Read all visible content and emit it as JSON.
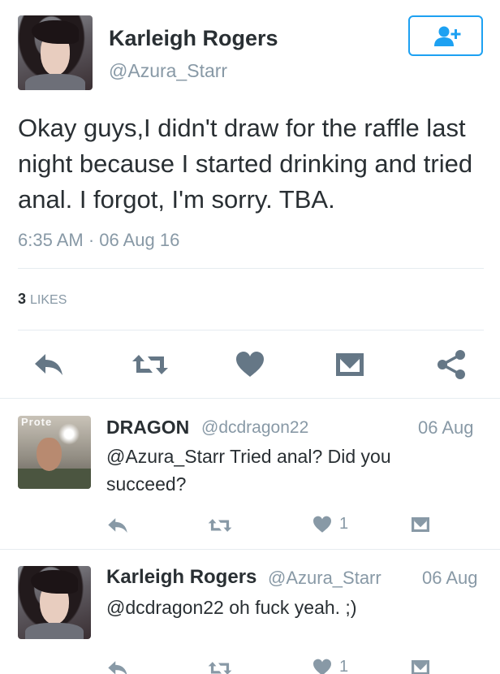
{
  "colors": {
    "text": "#292f33",
    "secondary": "#8899a6",
    "accent": "#1da1f2",
    "icon": "#657786",
    "divider": "#e6ecf0"
  },
  "tweet": {
    "author_name": "Karleigh Rogers",
    "author_handle": "@Azura_Starr",
    "follow_icon": "add-user-icon",
    "text": "Okay guys,I didn't draw for the raffle last night because I started drinking and tried anal. I forgot, I'm sorry.  TBA.",
    "timestamp": "6:35 AM · 06 Aug 16",
    "likes_count": "3",
    "likes_label": "LIKES",
    "actions": [
      "reply-icon",
      "retweet-icon",
      "heart-icon",
      "message-icon",
      "share-icon"
    ]
  },
  "replies": [
    {
      "name": "DRAGON",
      "handle": "@dcdragon22",
      "date": "06 Aug",
      "avatar_watermark": "Prote",
      "text": "@Azura_Starr Tried anal?  Did you succeed?",
      "like_count": "1"
    },
    {
      "name": "Karleigh Rogers",
      "handle": "@Azura_Starr",
      "date": "06 Aug",
      "text": "@dcdragon22 oh fuck yeah. ;)",
      "like_count": "1"
    }
  ]
}
